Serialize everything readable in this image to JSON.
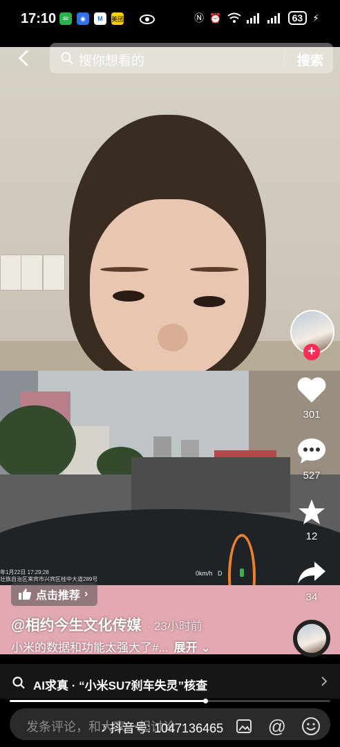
{
  "status_bar": {
    "time": "17:10",
    "app_icons": [
      "wechat-icon",
      "app-icon",
      "m-app-icon",
      "meituan-icon"
    ],
    "meituan_label": "美团",
    "battery": "63"
  },
  "top_bar": {
    "search_placeholder": "搜你想看的",
    "search_button": "搜索"
  },
  "video": {
    "cam_date": "年1月22日 17:29:28",
    "cam_location": "壮族自治区来宾市兴宾区桂中大道289号",
    "speed": "0km/h",
    "gear": "D"
  },
  "right_rail": {
    "likes": "301",
    "comments": "527",
    "favorites": "12",
    "shares": "34"
  },
  "info": {
    "promote": "点击推荐",
    "author": "@相约今生文化传媒",
    "time": "· 23小时前",
    "caption": "小米的数据和功能太强大了#...",
    "expand": "展开"
  },
  "ai_bar": {
    "label": "AI求真 · “小米SU7刹车失灵”核查"
  },
  "progress": {
    "value": 0.61
  },
  "comment_bar": {
    "placeholder": "发条评论，和大家一起讨论",
    "douyin_id": "抖音号: 1047136465"
  }
}
